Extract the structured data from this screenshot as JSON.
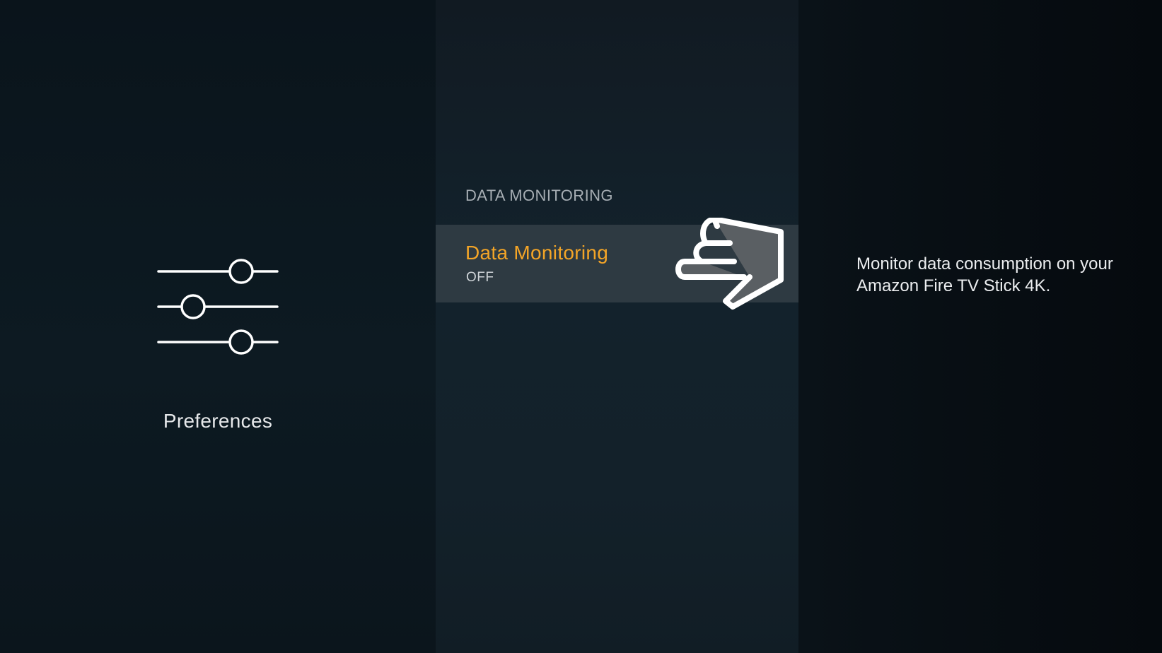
{
  "left_panel": {
    "icon": "sliders-icon",
    "category_label": "Preferences"
  },
  "middle_panel": {
    "section_heading": "DATA MONITORING",
    "selected_item": {
      "title": "Data Monitoring",
      "value": "OFF"
    },
    "pointer_icon": "pointing-hand-icon"
  },
  "right_panel": {
    "description": "Monitor data consumption on your Amazon Fire TV Stick 4K."
  },
  "colors": {
    "accent": "#f4a527",
    "selected_row": "#2e3a42",
    "text_primary": "#eceef0",
    "text_muted": "#a6adb3"
  }
}
